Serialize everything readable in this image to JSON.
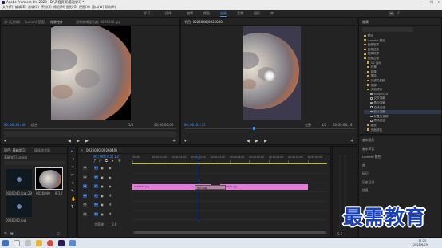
{
  "window": {
    "title": "Adobe Premiere Pro 2020 - D:\\声音资源\\基础学习 *",
    "controls": [
      "—",
      "❐",
      "✕"
    ]
  },
  "menu": [
    "文件(F)",
    "编辑(E)",
    "剪辑(C)",
    "序列(S)",
    "标记(M)",
    "图形(G)",
    "视图(V)",
    "窗口(W)",
    "帮助(H)"
  ],
  "workspace": {
    "tabs": [
      "学习",
      "组件",
      "编辑",
      "颜色",
      "效果",
      "音频",
      "图形",
      "库"
    ],
    "active_index": 4,
    "search_label": "≫"
  },
  "source": {
    "tabs": [
      "源:(无剪辑)",
      "Lumetri 范围",
      "效果控件",
      "音频剪辑混合器: 0026040.jpg"
    ],
    "active_index": 2,
    "timecode": "00;00;00;00",
    "fit": "适合",
    "zoom": "1/2",
    "duration": "00;00;00;00"
  },
  "program": {
    "tabs": [
      "节目: 0026040(0026040)"
    ],
    "timecode": "00;00;03;12",
    "fit": "完整",
    "ratio": "1/2",
    "duration": "00;00;08;14"
  },
  "effects": {
    "title": "效果",
    "tree": [
      {
        "label": "预设",
        "type": "folder",
        "indent": 1
      },
      {
        "label": "Lumetri 预设",
        "type": "folder",
        "indent": 1
      },
      {
        "label": "音频效果",
        "type": "folder",
        "indent": 1
      },
      {
        "label": "音频过渡",
        "type": "folder",
        "indent": 1
      },
      {
        "label": "视频效果",
        "type": "folder",
        "indent": 1
      },
      {
        "label": "视频过渡",
        "type": "folder",
        "indent": 1
      },
      {
        "label": "3D 运动",
        "type": "folder",
        "indent": 2
      },
      {
        "label": "内滑",
        "type": "folder",
        "indent": 2
      },
      {
        "label": "划像",
        "type": "folder",
        "indent": 2
      },
      {
        "label": "擦除",
        "type": "folder",
        "indent": 2
      },
      {
        "label": "沉浸式视频",
        "type": "folder",
        "indent": 2
      },
      {
        "label": "溶解",
        "type": "folder",
        "indent": 2
      },
      {
        "label": "页面剥落",
        "type": "folder",
        "indent": 2
      },
      {
        "label": "MorphCut",
        "type": "fx",
        "indent": 3
      },
      {
        "label": "交叉溶解",
        "type": "fx",
        "indent": 3
      },
      {
        "label": "叠加溶解",
        "type": "fx",
        "indent": 3
      },
      {
        "label": "白场过渡",
        "type": "fx",
        "indent": 3
      },
      {
        "label": "胶片溶解",
        "type": "fx",
        "indent": 3,
        "selected": true
      },
      {
        "label": "非叠加溶解",
        "type": "fx",
        "indent": 3
      },
      {
        "label": "黑场过渡",
        "type": "fx",
        "indent": 3
      },
      {
        "label": "缩放",
        "type": "folder",
        "indent": 2
      },
      {
        "label": "页面剥落",
        "type": "folder",
        "indent": 2
      }
    ],
    "side_panels": [
      "基本图形",
      "基本声音",
      "Lumetri 颜色",
      "库",
      "标记",
      "历史记录",
      "信息"
    ]
  },
  "project": {
    "tabs": [
      "项目: 基础学习",
      "媒体浏览器"
    ],
    "file": "基础学习.prproj",
    "items": [
      {
        "name": "0026040.jpg",
        "duration": "4;29"
      },
      {
        "name": "0026040",
        "duration": "8;14"
      },
      {
        "name": "0026040.jpg",
        "duration": ""
      }
    ]
  },
  "timeline": {
    "tab": "0026040(0026040)",
    "timecode": "00;00;03;12",
    "ruler": [
      "00;00",
      "00;00;01;00",
      "00;00;02;00",
      "00;00;03;00",
      "00;00;04;00",
      "00;00;05;00",
      "00;00;06;00",
      "00;00;07;00",
      "00;00;08;00",
      "00;00;09;00"
    ],
    "tracks": [
      "V3",
      "V2",
      "V1",
      "A1",
      "A2",
      "A3"
    ],
    "master": "主声道",
    "master_value": "0.0",
    "clips": [
      {
        "label": "0026040.jpg",
        "track": "V1",
        "start_s": 0.0,
        "end_s": 4.0
      },
      {
        "label": "胶片溶解",
        "track": "V1",
        "start_s": 3.2,
        "end_s": 4.8,
        "kind": "transition"
      },
      {
        "label": "0026040.jpg",
        "track": "V1",
        "start_s": 4.5,
        "end_s": 9.0
      }
    ],
    "playhead_s": 3.4,
    "ruler_max_s": 10
  },
  "taskbar": {
    "time": "17:25",
    "date": "2021/6/29"
  },
  "watermark": "最需教育"
}
